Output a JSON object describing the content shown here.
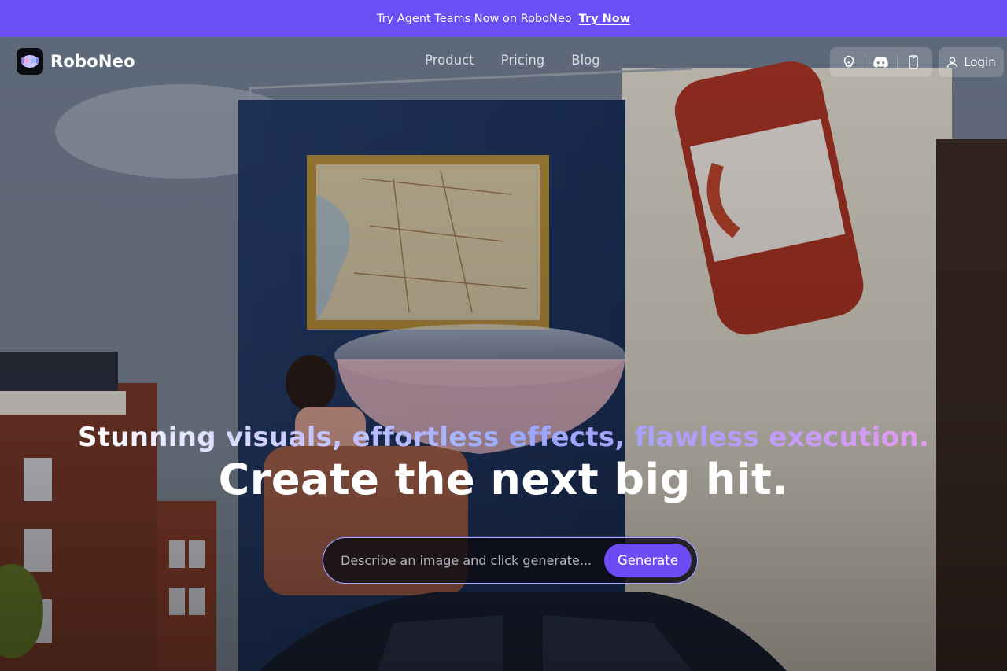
{
  "announcement": {
    "text": "Try Agent Teams Now on RoboNeo",
    "link_label": "Try Now"
  },
  "brand": {
    "name": "RoboNeo"
  },
  "nav": {
    "items": [
      {
        "label": "Product"
      },
      {
        "label": "Pricing"
      },
      {
        "label": "Blog"
      }
    ],
    "icons": [
      "lightbulb-icon",
      "discord-icon",
      "mobile-icon"
    ],
    "login_label": "Login"
  },
  "hero": {
    "tagline": "Stunning visuals, effortless effects, flawless execution.",
    "headline": "Create the next big hit."
  },
  "prompt": {
    "placeholder": "Describe an image and click generate...",
    "value": "",
    "generate_label": "Generate"
  },
  "colors": {
    "accent": "#6c4ef5",
    "button": "#6d4cf6",
    "prompt_border": "#a9a7ff"
  }
}
